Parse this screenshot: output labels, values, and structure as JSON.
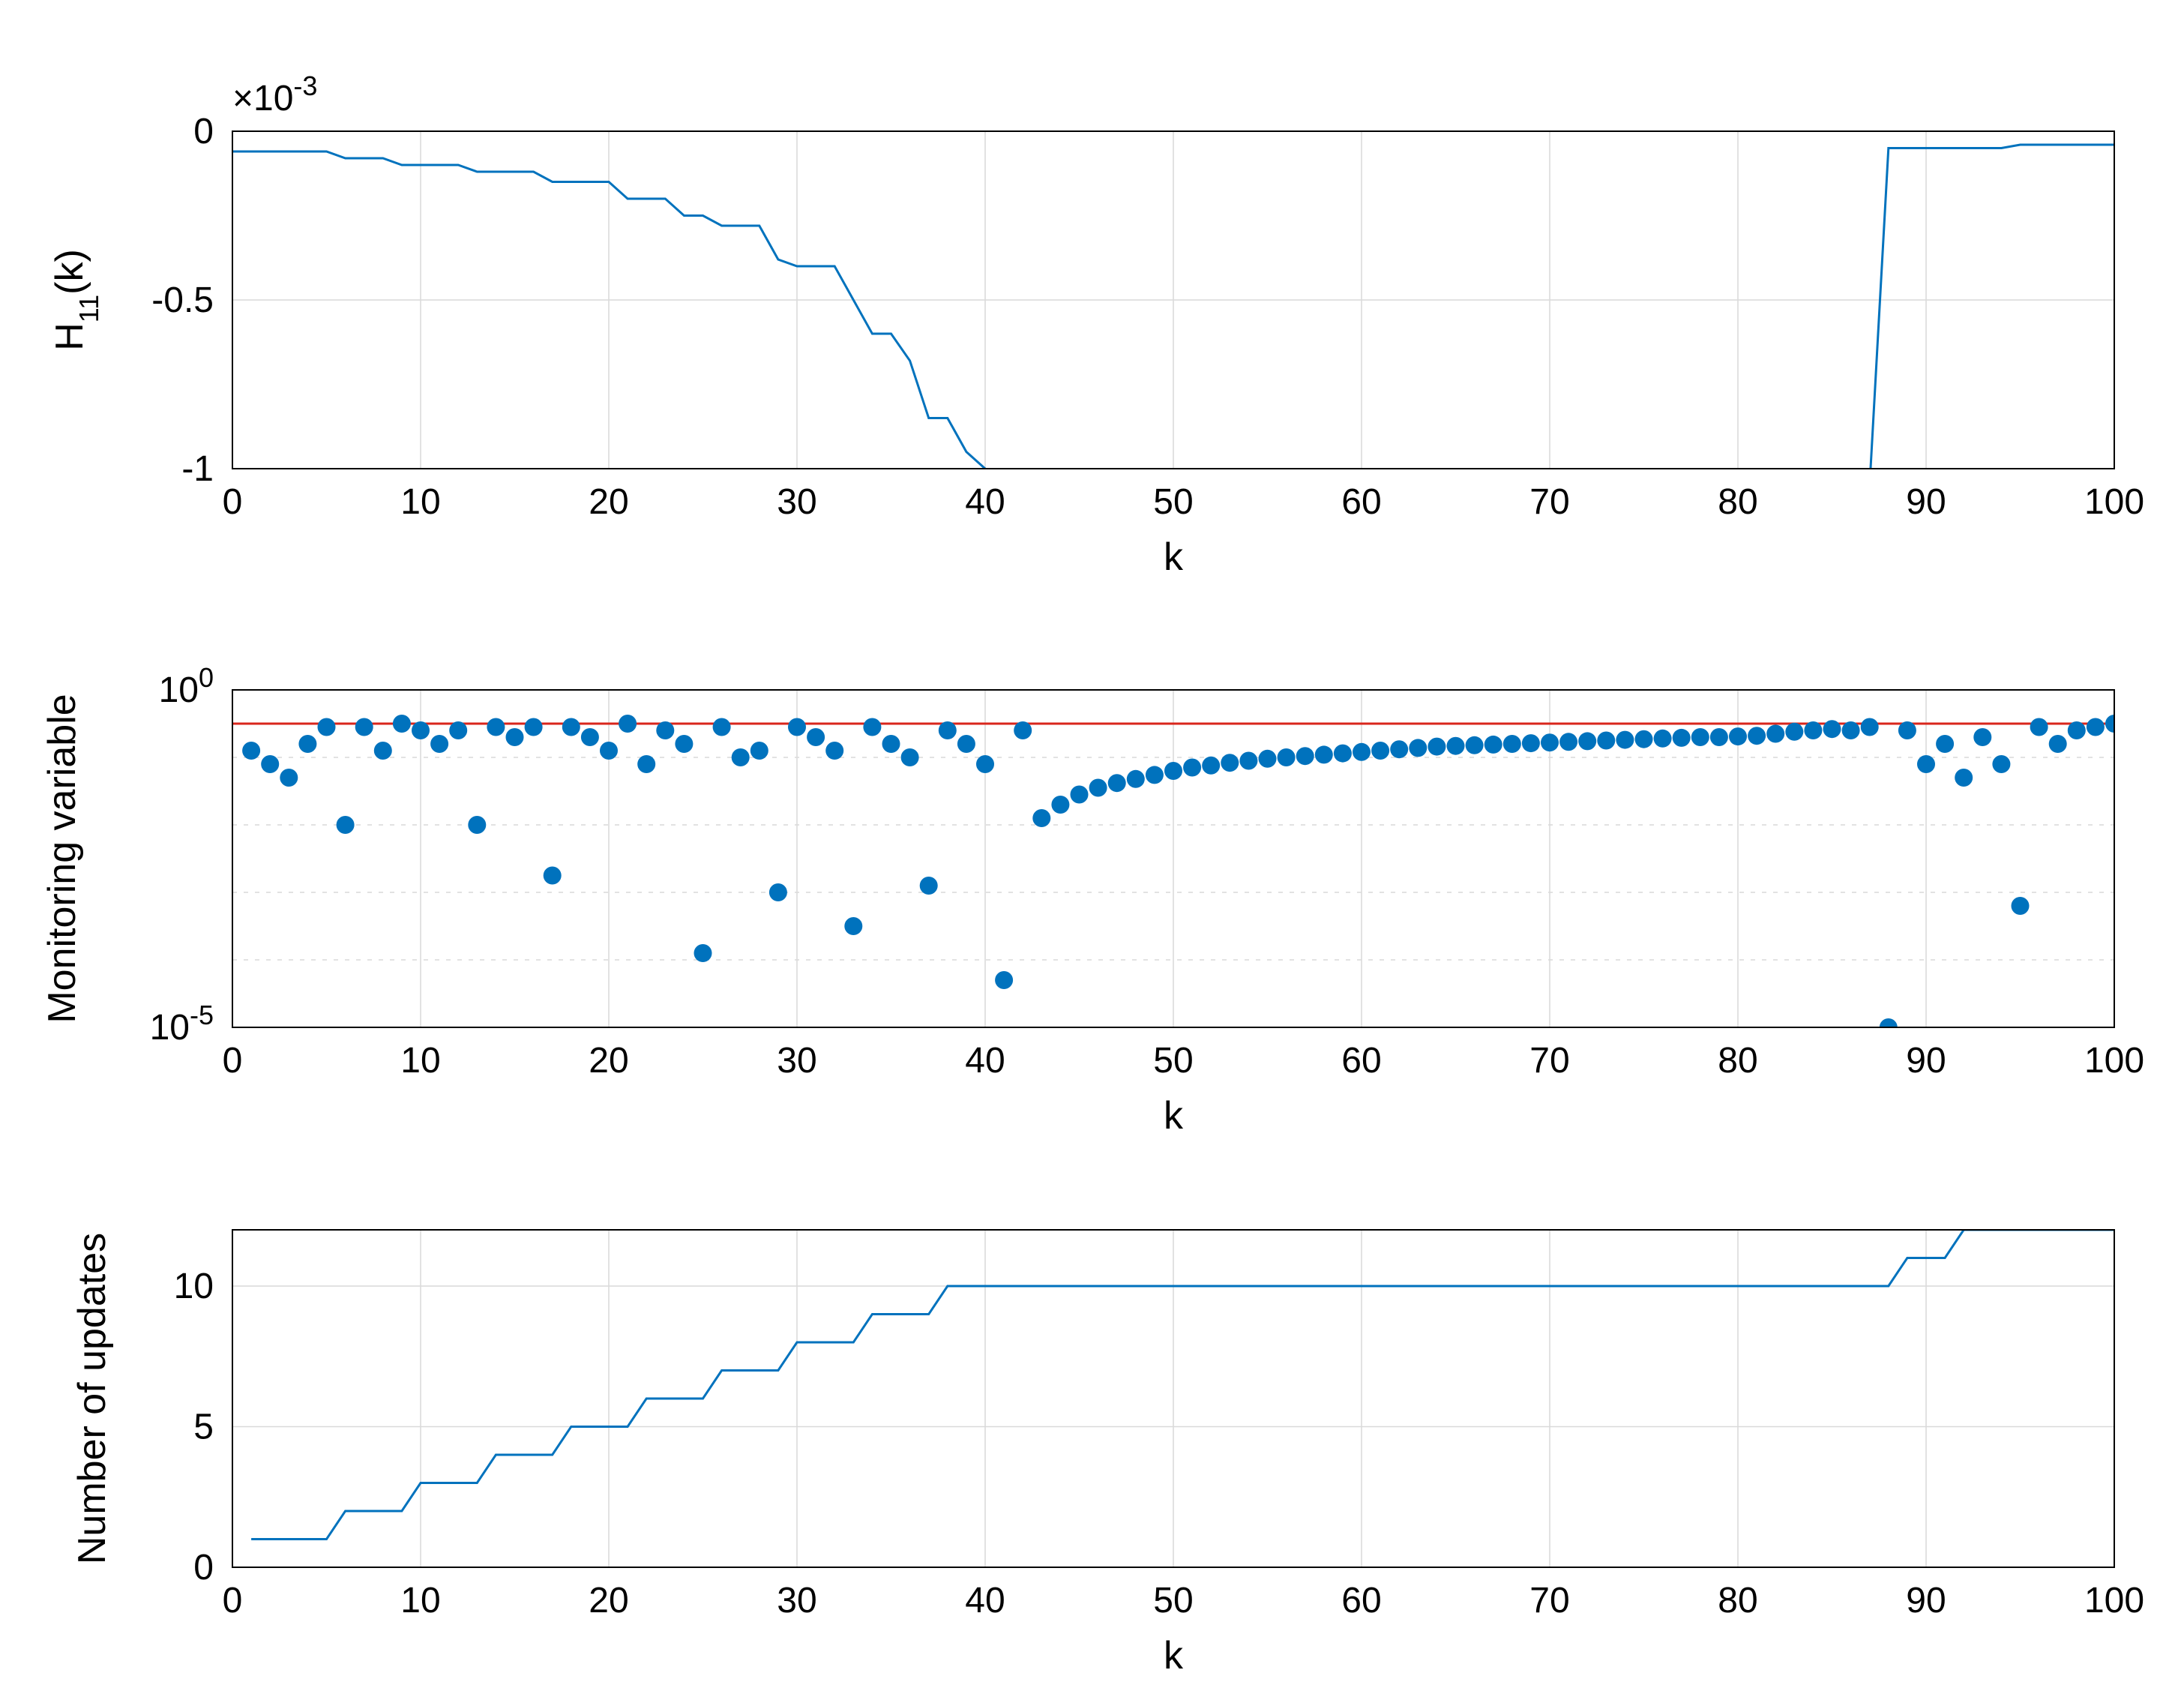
{
  "chart_data": [
    {
      "type": "line",
      "title": "",
      "xlabel": "k",
      "ylabel": "H_{11}(k)",
      "yexp_label": "×10^{-3}",
      "xlim": [
        0,
        100
      ],
      "ylim": [
        -1,
        0
      ],
      "xticks": [
        0,
        10,
        20,
        30,
        40,
        50,
        60,
        70,
        80,
        90,
        100
      ],
      "yticks": [
        -1,
        -0.5,
        0
      ],
      "x": [
        0,
        1,
        2,
        3,
        4,
        5,
        6,
        7,
        8,
        9,
        10,
        11,
        12,
        13,
        14,
        15,
        16,
        17,
        18,
        19,
        20,
        21,
        22,
        23,
        24,
        25,
        26,
        27,
        28,
        29,
        30,
        31,
        32,
        33,
        34,
        35,
        36,
        37,
        38,
        39,
        40,
        41,
        42,
        43,
        44,
        45,
        46,
        47,
        48,
        49,
        50,
        51,
        52,
        53,
        54,
        55,
        56,
        57,
        58,
        59,
        60,
        61,
        62,
        63,
        64,
        65,
        66,
        67,
        68,
        69,
        70,
        71,
        72,
        73,
        74,
        75,
        76,
        77,
        78,
        79,
        80,
        81,
        82,
        83,
        84,
        85,
        86,
        87,
        88,
        89,
        90,
        91,
        92,
        93,
        94,
        95,
        96,
        97,
        98,
        99,
        100
      ],
      "y": [
        -0.06,
        -0.06,
        -0.06,
        -0.06,
        -0.06,
        -0.06,
        -0.08,
        -0.08,
        -0.08,
        -0.1,
        -0.1,
        -0.1,
        -0.1,
        -0.12,
        -0.12,
        -0.12,
        -0.12,
        -0.15,
        -0.15,
        -0.15,
        -0.15,
        -0.2,
        -0.2,
        -0.2,
        -0.25,
        -0.25,
        -0.28,
        -0.28,
        -0.28,
        -0.38,
        -0.4,
        -0.4,
        -0.4,
        -0.5,
        -0.6,
        -0.6,
        -0.68,
        -0.85,
        -0.85,
        -0.95,
        -1.0,
        -1.05,
        -1.05,
        -1.05,
        -1.05,
        -1.05,
        -1.05,
        -1.05,
        -1.05,
        -1.05,
        -1.05,
        -1.05,
        -1.05,
        -1.05,
        -1.05,
        -1.05,
        -1.05,
        -1.05,
        -1.05,
        -1.05,
        -1.05,
        -1.05,
        -1.05,
        -1.05,
        -1.05,
        -1.05,
        -1.05,
        -1.05,
        -1.05,
        -1.05,
        -1.05,
        -1.05,
        -1.05,
        -1.05,
        -1.05,
        -1.05,
        -1.05,
        -1.05,
        -1.05,
        -1.05,
        -1.05,
        -1.05,
        -1.05,
        -1.05,
        -1.05,
        -1.05,
        -1.05,
        -1.05,
        -0.05,
        -0.05,
        -0.05,
        -0.05,
        -0.05,
        -0.05,
        -0.05,
        -0.04,
        -0.04,
        -0.04,
        -0.04,
        -0.04,
        -0.04
      ]
    },
    {
      "type": "scatter",
      "title": "",
      "xlabel": "k",
      "ylabel": "Monitoring variable",
      "xlim": [
        0,
        100
      ],
      "ylim_log10": [
        -5,
        0
      ],
      "xticks": [
        0,
        10,
        20,
        30,
        40,
        50,
        60,
        70,
        80,
        90,
        100
      ],
      "ytick_labels": [
        "10^{-5}",
        "10^{0}"
      ],
      "minor_grid_log10": [
        -4,
        -3,
        -2,
        -1
      ],
      "reference_line_log10": -0.5,
      "x": [
        1,
        2,
        3,
        4,
        5,
        6,
        7,
        8,
        9,
        10,
        11,
        12,
        13,
        14,
        15,
        16,
        17,
        18,
        19,
        20,
        21,
        22,
        23,
        24,
        25,
        26,
        27,
        28,
        29,
        30,
        31,
        32,
        33,
        34,
        35,
        36,
        37,
        38,
        39,
        40,
        41,
        42,
        43,
        44,
        45,
        46,
        47,
        48,
        49,
        50,
        51,
        52,
        53,
        54,
        55,
        56,
        57,
        58,
        59,
        60,
        61,
        62,
        63,
        64,
        65,
        66,
        67,
        68,
        69,
        70,
        71,
        72,
        73,
        74,
        75,
        76,
        77,
        78,
        79,
        80,
        81,
        82,
        83,
        84,
        85,
        86,
        87,
        88,
        89,
        90,
        91,
        92,
        93,
        94,
        95,
        96,
        97,
        98,
        99,
        100
      ],
      "y_log10": [
        -0.9,
        -1.1,
        -1.3,
        -0.8,
        -0.55,
        -2.0,
        -0.55,
        -0.9,
        -0.5,
        -0.6,
        -0.8,
        -0.6,
        -2.0,
        -0.55,
        -0.7,
        -0.55,
        -2.75,
        -0.55,
        -0.7,
        -0.9,
        -0.5,
        -1.1,
        -0.6,
        -0.8,
        -3.9,
        -0.55,
        -1.0,
        -0.9,
        -3.0,
        -0.55,
        -0.7,
        -0.9,
        -3.5,
        -0.55,
        -0.8,
        -1.0,
        -2.9,
        -0.6,
        -0.8,
        -1.1,
        -4.3,
        -0.6,
        -1.9,
        -1.7,
        -1.55,
        -1.45,
        -1.38,
        -1.32,
        -1.26,
        -1.2,
        -1.15,
        -1.12,
        -1.08,
        -1.05,
        -1.02,
        -1.0,
        -0.98,
        -0.96,
        -0.94,
        -0.92,
        -0.9,
        -0.88,
        -0.86,
        -0.84,
        -0.83,
        -0.82,
        -0.81,
        -0.8,
        -0.79,
        -0.78,
        -0.77,
        -0.76,
        -0.75,
        -0.74,
        -0.73,
        -0.72,
        -0.71,
        -0.7,
        -0.7,
        -0.69,
        -0.68,
        -0.65,
        -0.62,
        -0.6,
        -0.58,
        -0.6,
        -0.55,
        -5.0,
        -0.6,
        -1.1,
        -0.8,
        -1.3,
        -0.7,
        -1.1,
        -3.2,
        -0.55,
        -0.8,
        -0.6,
        -0.55,
        -0.5
      ]
    },
    {
      "type": "line",
      "title": "",
      "xlabel": "k",
      "ylabel": "Number of updates",
      "xlim": [
        0,
        100
      ],
      "ylim": [
        0,
        12
      ],
      "xticks": [
        0,
        10,
        20,
        30,
        40,
        50,
        60,
        70,
        80,
        90,
        100
      ],
      "yticks": [
        0,
        5,
        10
      ],
      "x": [
        0,
        1,
        5,
        6,
        9,
        10,
        13,
        14,
        17,
        18,
        21,
        22,
        25,
        26,
        29,
        30,
        33,
        34,
        37,
        38,
        41,
        42,
        88,
        89,
        91,
        92,
        95,
        96,
        100
      ],
      "y": [
        1,
        1,
        1,
        2,
        2,
        3,
        3,
        4,
        4,
        5,
        5,
        6,
        6,
        7,
        7,
        8,
        8,
        9,
        9,
        10,
        10,
        10,
        10,
        11,
        11,
        12,
        12,
        12,
        12
      ],
      "step_pairs": {
        "k_thresholds": [
          1,
          5,
          9,
          13,
          17,
          21,
          25,
          29,
          33,
          37,
          41,
          88,
          91,
          95
        ],
        "levels": [
          1,
          2,
          3,
          4,
          5,
          6,
          7,
          8,
          9,
          10,
          10,
          11,
          12,
          12
        ]
      }
    }
  ],
  "labels": {
    "x": "k",
    "y1": "H",
    "y1_sub": "11",
    "y1_suffix": "(k)",
    "y1_exp_prefix": "×10",
    "y1_exp_sup": "-3",
    "y2": "Monitoring variable",
    "y3": "Number of updates",
    "y2_tick_lo_base": "10",
    "y2_tick_lo_sup": "-5",
    "y2_tick_hi_base": "10",
    "y2_tick_hi_sup": "0"
  },
  "plot1_yticks": [
    "-1",
    "-0.5",
    "0"
  ],
  "plot3_yticks": [
    "0",
    "5",
    "10"
  ],
  "xticks_display": [
    "0",
    "10",
    "20",
    "30",
    "40",
    "50",
    "60",
    "70",
    "80",
    "90",
    "100"
  ]
}
